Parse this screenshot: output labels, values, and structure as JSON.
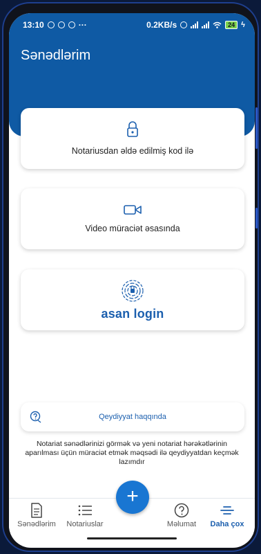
{
  "status_bar": {
    "time": "13:10",
    "ellipsis": "···",
    "net_speed": "0.2KB/s",
    "battery": "24"
  },
  "page": {
    "title": "Sənədlərim"
  },
  "options": [
    {
      "label": "Notariusdan əldə edilmiş kod ilə",
      "icon": "lock-icon"
    },
    {
      "label": "Video müraciət əsasında",
      "icon": "video-camera-icon"
    },
    {
      "label": "asan login",
      "icon": "fingerprint-icon"
    }
  ],
  "info": {
    "registration_link": "Qeydiyyat haqqında",
    "description": "Notariat sənədlərinizi görmək və yeni notariat hərəkətlərinin aparılması üçün müraciət etmək məqsədi ilə qeydiyyatdan keçmək lazımdır"
  },
  "bottom_nav": [
    {
      "label": "Sənədlərim",
      "icon": "document-icon"
    },
    {
      "label": "Notariuslar",
      "icon": "list-icon"
    },
    {
      "label": "Məlumat",
      "icon": "help-circle-icon"
    },
    {
      "label": "Daha çox",
      "icon": "menu-icon"
    }
  ],
  "fab": {
    "label": "+"
  },
  "colors": {
    "brand": "#0f5aa4",
    "accent": "#1b5fae",
    "fab": "#1976d2"
  }
}
